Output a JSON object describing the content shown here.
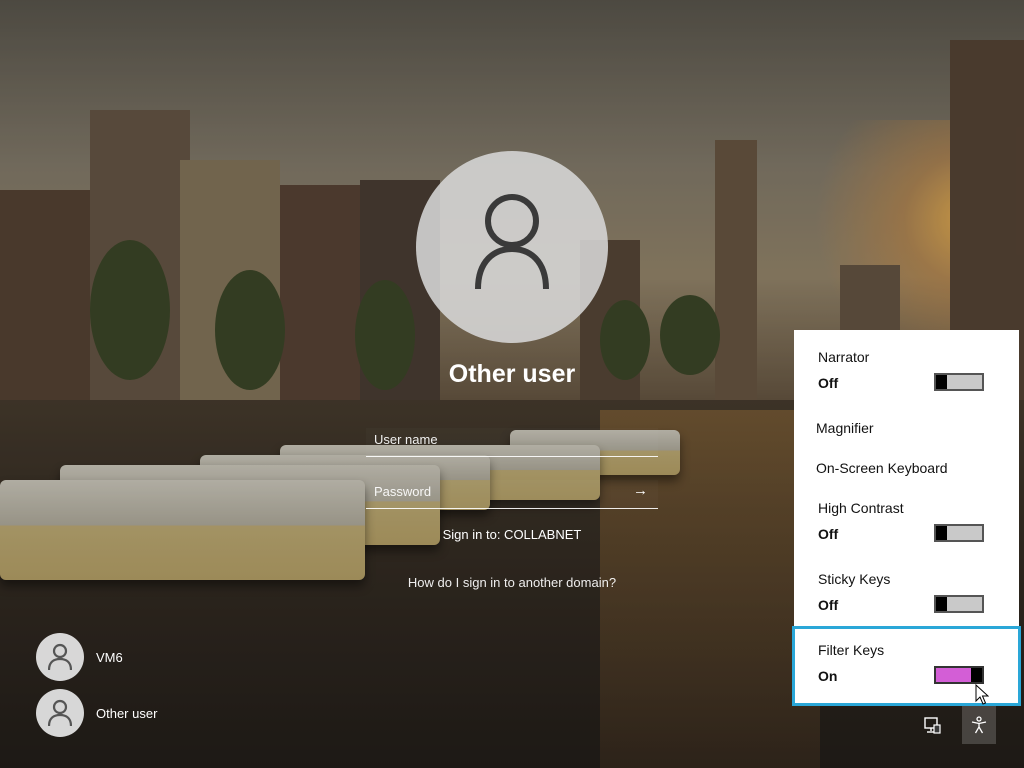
{
  "signin": {
    "user_title": "Other user",
    "username_placeholder": "User name",
    "password_placeholder": "Password",
    "submit_arrow": "→",
    "sign_in_to": "Sign in to: COLLABNET",
    "domain_link": "How do I sign in to another domain?"
  },
  "users": [
    {
      "name": "VM6"
    },
    {
      "name": "Other user"
    }
  ],
  "ease_of_access": {
    "items": [
      {
        "label": "Narrator",
        "state": "Off"
      },
      {
        "label": "Magnifier"
      },
      {
        "label": "On-Screen Keyboard"
      },
      {
        "label": "High Contrast",
        "state": "Off"
      },
      {
        "label": "Sticky Keys",
        "state": "Off"
      },
      {
        "label": "Filter Keys",
        "state": "On"
      }
    ],
    "toggle_on_color": "#d35ed6",
    "focus_color": "#2aa7d8"
  },
  "tray": {
    "network_icon": "network-icon",
    "ease_icon": "ease-of-access-icon"
  }
}
